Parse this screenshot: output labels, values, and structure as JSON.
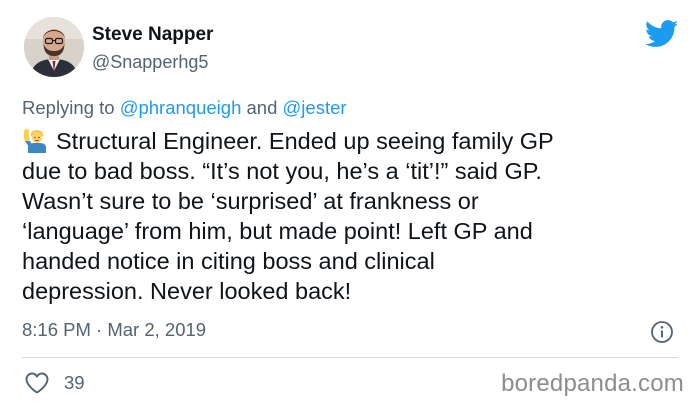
{
  "author": {
    "display_name": "Steve Napper",
    "handle": "@Snapperhg5",
    "avatar_icon": "profile-photo"
  },
  "reply": {
    "prefix": "Replying to",
    "mention_1": "@phranqueigh",
    "connector": "and",
    "mention_2": "@jester"
  },
  "tweet": {
    "emoji_icon": "man-raising-hand-emoji",
    "lines": [
      "Structural Engineer. Ended up seeing family GP",
      "due to bad boss. “It’s not you, he’s a ‘tit’!” said GP.",
      "Wasn’t sure to be ‘surprised’ at frankness or",
      "‘language’ from him, but made point! Left GP and",
      "handed notice in citing boss and clinical",
      "depression. Never looked back!"
    ],
    "timestamp": "8:16 PM · Mar 2, 2019",
    "like_count": "39"
  },
  "icons": {
    "brand": "twitter-bird-icon",
    "info": "info-icon",
    "like": "heart-icon"
  },
  "colors": {
    "brand_blue": "#1d9bf0",
    "secondary_text": "#536471",
    "primary_text": "#0f1419",
    "divider": "#cfd9de"
  },
  "watermark": "boredpanda.com"
}
